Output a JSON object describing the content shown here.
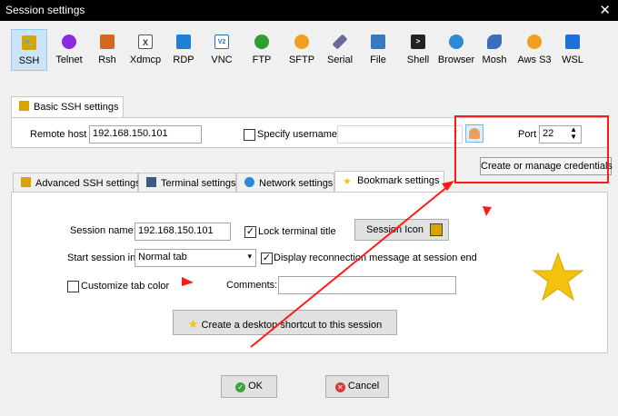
{
  "window": {
    "title": "Session settings",
    "close_label": "✕"
  },
  "toolbar": {
    "items": [
      {
        "label": "SSH",
        "icon": "ssh-icon",
        "color": "#d9a400"
      },
      {
        "label": "Telnet",
        "icon": "telnet-icon",
        "color": "#8a2be2"
      },
      {
        "label": "Rsh",
        "icon": "rsh-icon",
        "color": "#d2691e"
      },
      {
        "label": "Xdmcp",
        "icon": "xdmcp-icon",
        "color": "#555555"
      },
      {
        "label": "RDP",
        "icon": "rdp-icon",
        "color": "#1e7fd8"
      },
      {
        "label": "VNC",
        "icon": "vnc-icon",
        "color": "#2a6fbf"
      },
      {
        "label": "FTP",
        "icon": "ftp-icon",
        "color": "#2e9e2e"
      },
      {
        "label": "SFTP",
        "icon": "sftp-icon",
        "color": "#f0a020"
      },
      {
        "label": "Serial",
        "icon": "serial-icon",
        "color": "#6a6a9a"
      },
      {
        "label": "File",
        "icon": "file-icon",
        "color": "#3a7abf"
      },
      {
        "label": "Shell",
        "icon": "shell-icon",
        "color": "#222222"
      },
      {
        "label": "Browser",
        "icon": "browser-icon",
        "color": "#2a8ad8"
      },
      {
        "label": "Mosh",
        "icon": "mosh-icon",
        "color": "#3a6fbf"
      },
      {
        "label": "Aws S3",
        "icon": "aws-s3-icon",
        "color": "#f0a020"
      },
      {
        "label": "WSL",
        "icon": "wsl-icon",
        "color": "#1e6fd8"
      }
    ],
    "active": "SSH"
  },
  "basic": {
    "tab_label": "Basic SSH settings",
    "remote_host_label": "Remote host *",
    "remote_host_value": "192.168.150.101",
    "specify_username_label": "Specify username",
    "specify_username_checked": false,
    "username_value": "",
    "port_label": "Port",
    "port_value": "22",
    "credentials_tooltip": "Create or manage credentials"
  },
  "tabs": [
    {
      "label": "Advanced SSH settings",
      "icon": "advanced-ssh-icon"
    },
    {
      "label": "Terminal settings",
      "icon": "terminal-settings-icon"
    },
    {
      "label": "Network settings",
      "icon": "network-settings-icon"
    },
    {
      "label": "Bookmark settings",
      "icon": "bookmark-star-icon"
    }
  ],
  "bookmark": {
    "session_name_label": "Session name:",
    "session_name_value": "192.168.150.101",
    "lock_title_label": "Lock terminal title",
    "lock_title_checked": true,
    "session_icon_label": "Session Icon",
    "start_session_label": "Start session in",
    "start_session_value": "Normal tab",
    "display_reconnect_label": "Display reconnection message at session end",
    "display_reconnect_checked": true,
    "customize_color_label": "Customize tab color",
    "customize_color_checked": false,
    "comments_label": "Comments:",
    "comments_value": "",
    "shortcut_label": "Create a desktop shortcut to this session"
  },
  "buttons": {
    "ok_label": "OK",
    "cancel_label": "Cancel"
  },
  "colors": {
    "accent_selected": "#cce4f7",
    "annotation_red": "#ff1a1a",
    "star": "#f4c20d",
    "check": "✓"
  }
}
